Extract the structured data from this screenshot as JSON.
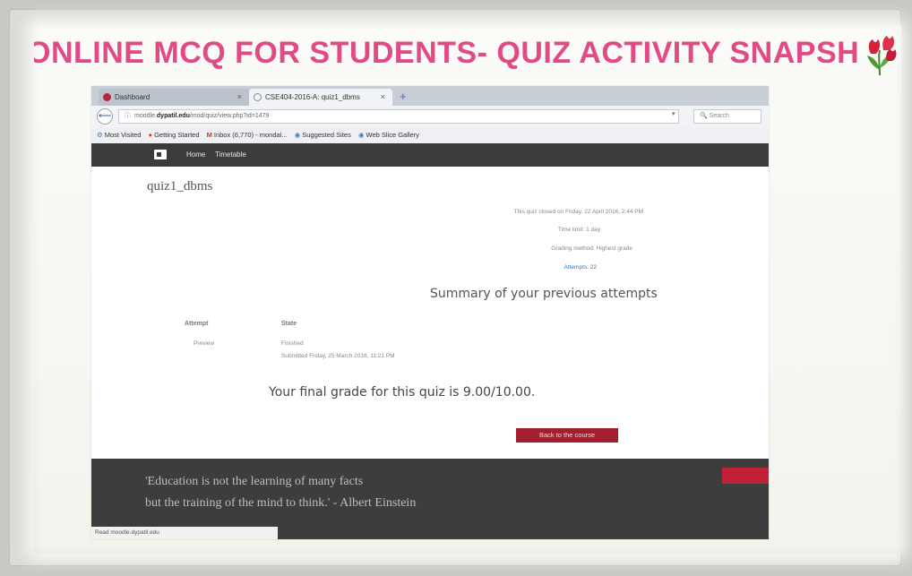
{
  "slide": {
    "title": "ONLINE MCQ FOR STUDENTS- QUIZ ACTIVITY SNAPSHOT",
    "accent_color": "#e24a86"
  },
  "browser": {
    "tabs": [
      {
        "label": "Dashboard",
        "close": "×"
      },
      {
        "label": "CSE404-2016-A: quiz1_dbms",
        "close": "×"
      }
    ],
    "new_tab": "+",
    "back_button": "⟵",
    "url_info": "ⓘ",
    "url_prefix": "moodle.",
    "url_host": "dypatil.edu",
    "url_path": "/mod/quiz/view.php?id=1479",
    "url_dropdown": "▾",
    "search_placeholder": "🔍 Search",
    "bookmarks": [
      {
        "icon": "⚙",
        "label": "Most Visited"
      },
      {
        "icon": "●",
        "label": "Getting Started"
      },
      {
        "icon": "M",
        "label": "Inbox (6,770) - mondal..."
      },
      {
        "icon": "◉",
        "label": "Suggested Sites"
      },
      {
        "icon": "◉",
        "label": "Web Slice Gallery"
      }
    ]
  },
  "nav": {
    "home": "Home",
    "timetable": "Timetable"
  },
  "quiz": {
    "name": "quiz1_dbms",
    "closed_info": "This quiz closed on Friday, 22 April 2016, 2:44 PM",
    "time_limit": "Time limit: 1 day",
    "grading_method": "Grading method: Highest grade",
    "attempts": "Attempts: 22",
    "summary_title": "Summary of your previous attempts",
    "table": {
      "headers": [
        "Attempt",
        "State"
      ],
      "rows": [
        {
          "attempt": "Preview",
          "state": "Finished",
          "submitted": "Submitted Friday, 25 March 2016, 11:21 PM"
        }
      ]
    },
    "final_grade": "Your final grade for this quiz is 9.00/10.00.",
    "back_button": "Back to the course",
    "button_color": "#a0202f"
  },
  "footer": {
    "quote": "'Education is not the learning of many facts\nbut the training of the mind to think.' - Albert Einstein"
  },
  "status_bar": "Read moodle.dypatil.edu"
}
